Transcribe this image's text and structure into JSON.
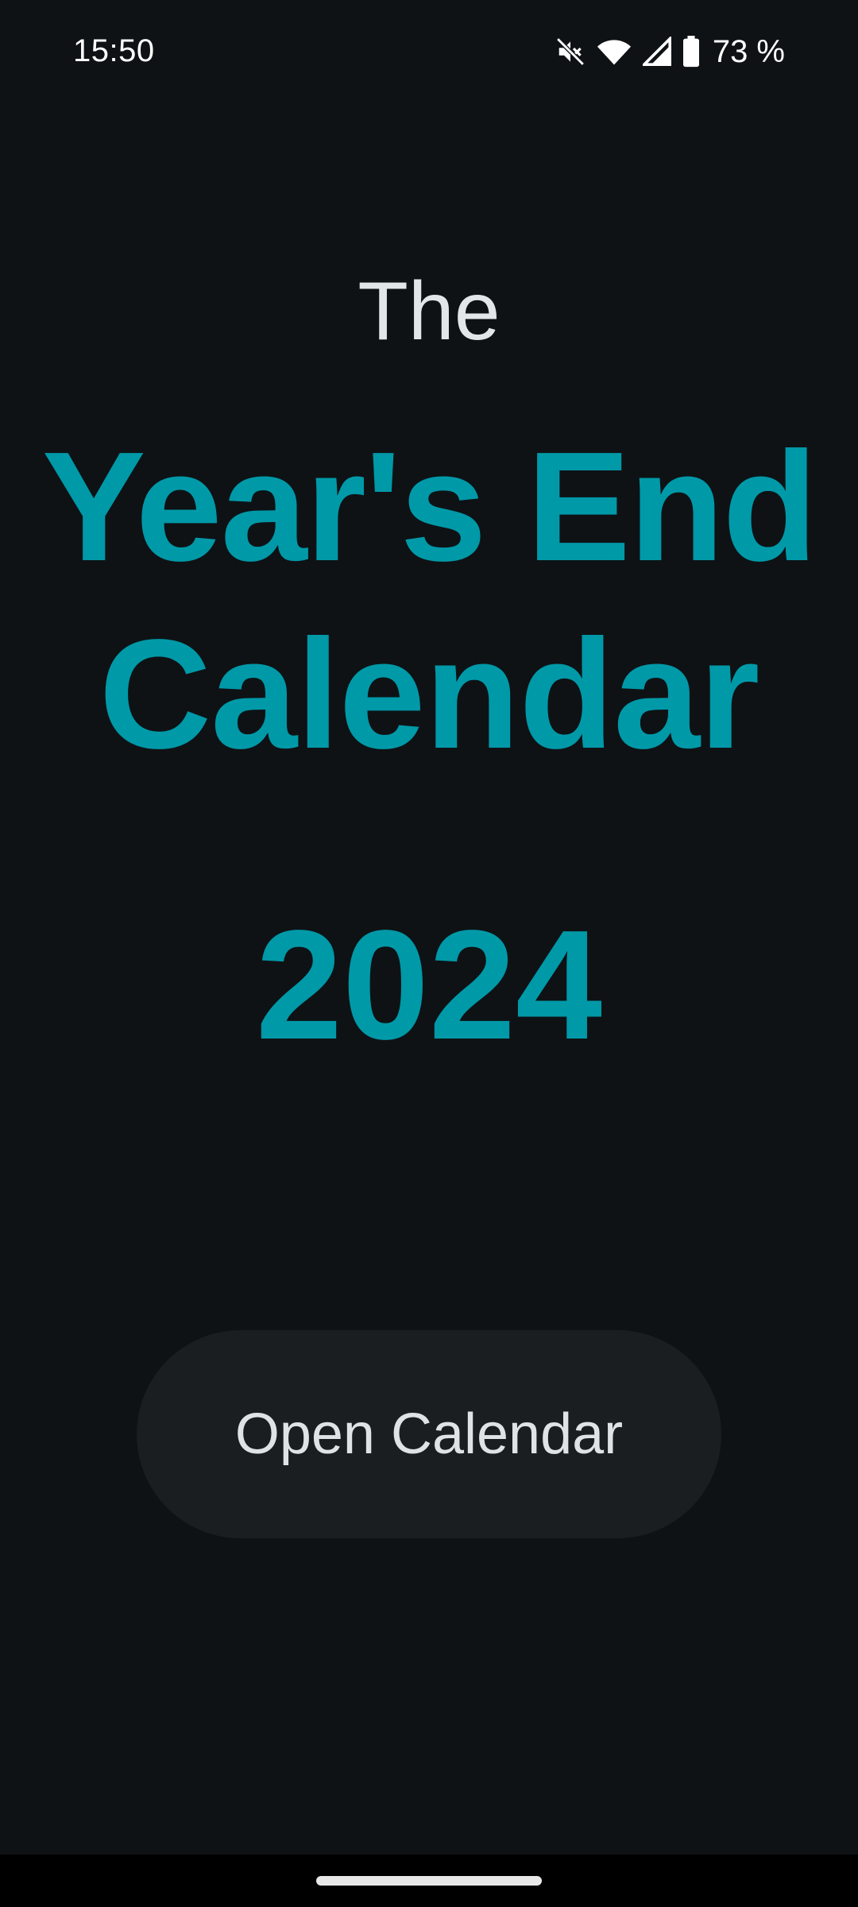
{
  "status_bar": {
    "time": "15:50",
    "battery_percent": "73 %",
    "icons": [
      "mute-icon",
      "wifi-icon",
      "signal-icon",
      "battery-icon"
    ]
  },
  "title": {
    "prefix": "The",
    "line1": "Year's End",
    "line2": "Calendar",
    "year": "2024"
  },
  "actions": {
    "open_calendar_label": "Open Calendar"
  },
  "colors": {
    "background": "#0e1215",
    "accent": "#0099a8",
    "text_primary": "#e3e6e8",
    "button_background": "#1a1e21"
  }
}
